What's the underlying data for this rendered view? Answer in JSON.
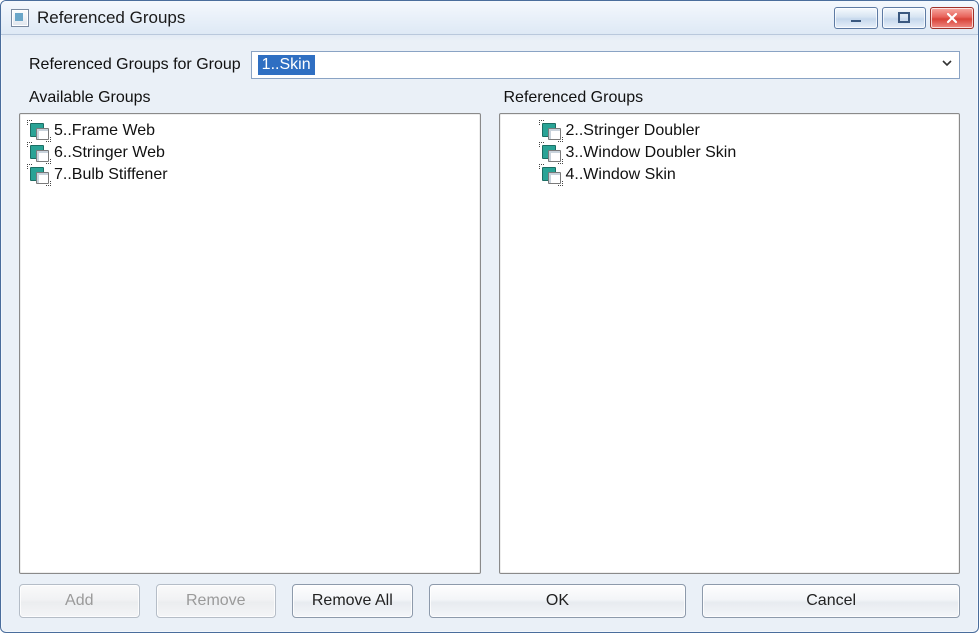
{
  "window": {
    "title": "Referenced Groups"
  },
  "toolbar": {
    "group_for_label": "Referenced Groups for Group",
    "selected_group": "1..Skin"
  },
  "labels": {
    "available": "Available Groups",
    "referenced": "Referenced Groups"
  },
  "available_groups": [
    {
      "label": "5..Frame Web"
    },
    {
      "label": "6..Stringer Web"
    },
    {
      "label": "7..Bulb Stiffener"
    }
  ],
  "referenced_groups": [
    {
      "label": "2..Stringer Doubler"
    },
    {
      "label": "3..Window Doubler Skin"
    },
    {
      "label": "4..Window Skin"
    }
  ],
  "buttons": {
    "add": "Add",
    "remove": "Remove",
    "remove_all": "Remove All",
    "ok": "OK",
    "cancel": "Cancel"
  }
}
